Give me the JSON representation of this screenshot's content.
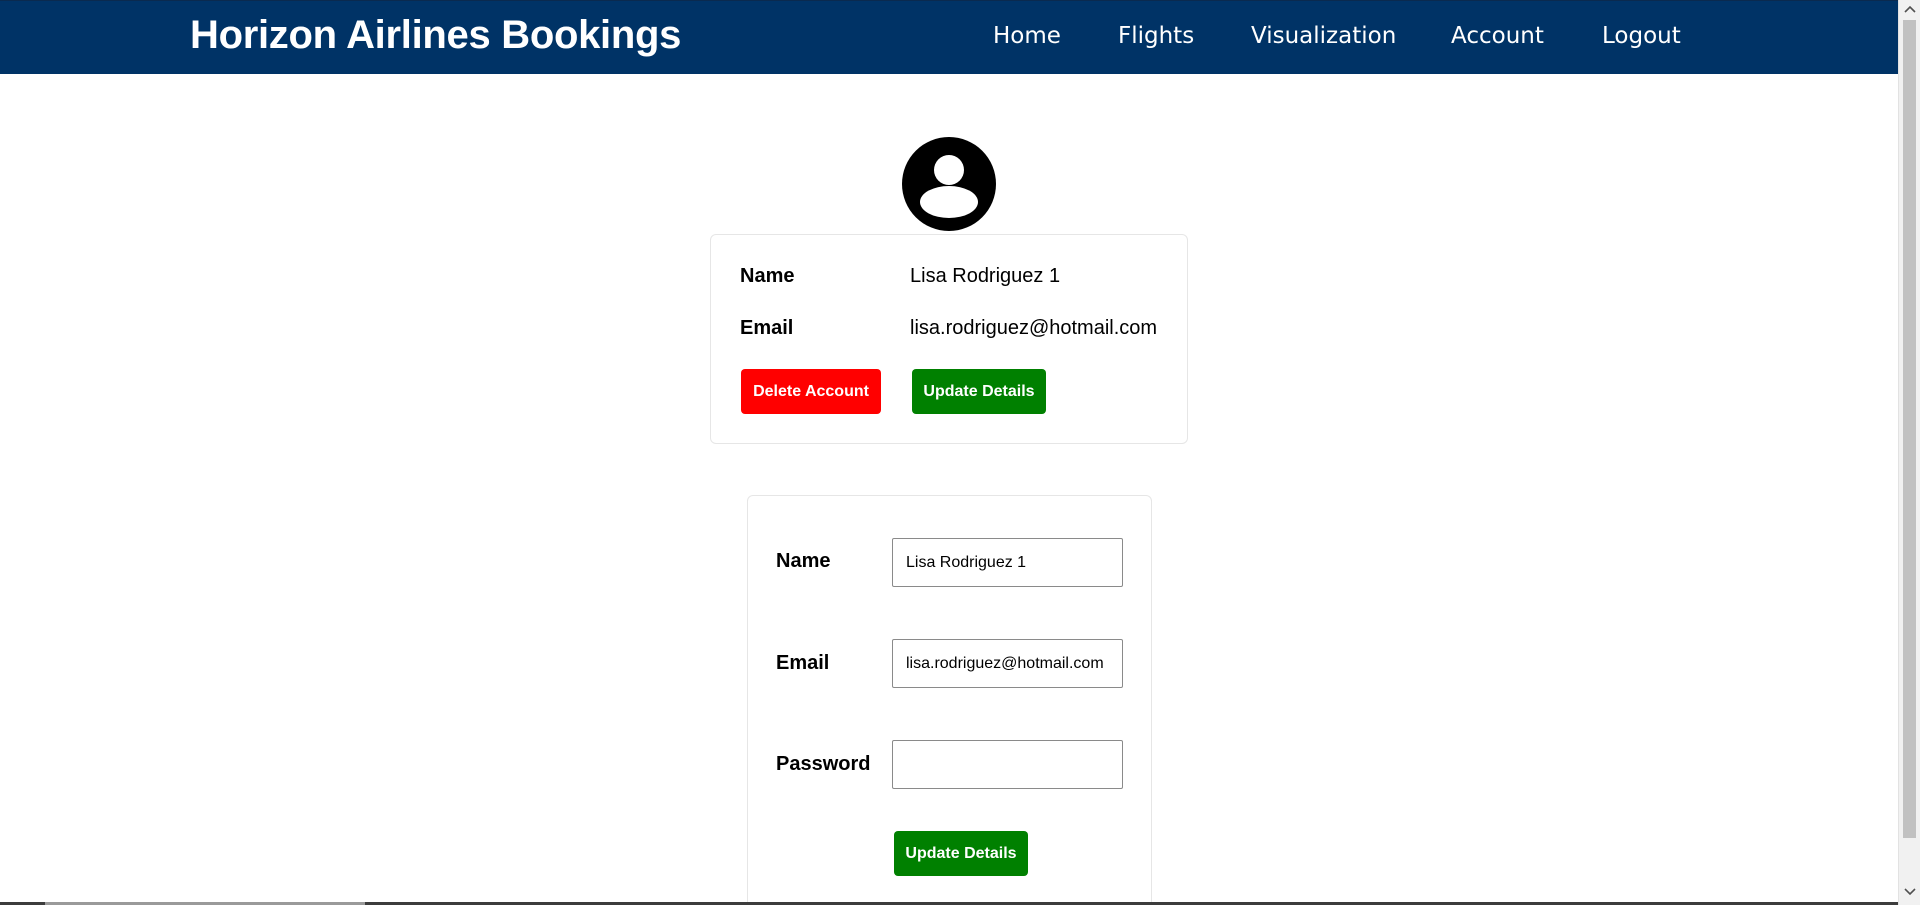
{
  "header": {
    "brand": "Horizon Airlines Bookings",
    "nav": [
      {
        "label": "Home"
      },
      {
        "label": "Flights"
      },
      {
        "label": "Visualization"
      },
      {
        "label": "Account"
      },
      {
        "label": "Logout"
      }
    ],
    "background_color": "#003366"
  },
  "avatar": {
    "icon": "user-circle-icon"
  },
  "profile": {
    "name_label": "Name",
    "name_value": "Lisa Rodriguez 1",
    "email_label": "Email",
    "email_value": "lisa.rodriguez@hotmail.com",
    "delete_label": "Delete Account",
    "update_label": "Update Details",
    "delete_color": "#ff0000",
    "update_color": "#008000"
  },
  "form": {
    "name_label": "Name",
    "name_value": "Lisa Rodriguez 1",
    "email_label": "Email",
    "email_value": "lisa.rodriguez@hotmail.com",
    "password_label": "Password",
    "password_value": "",
    "submit_label": "Update Details"
  },
  "scrollbar": {
    "up_icon": "chevron-up-icon",
    "down_icon": "chevron-down-icon"
  }
}
